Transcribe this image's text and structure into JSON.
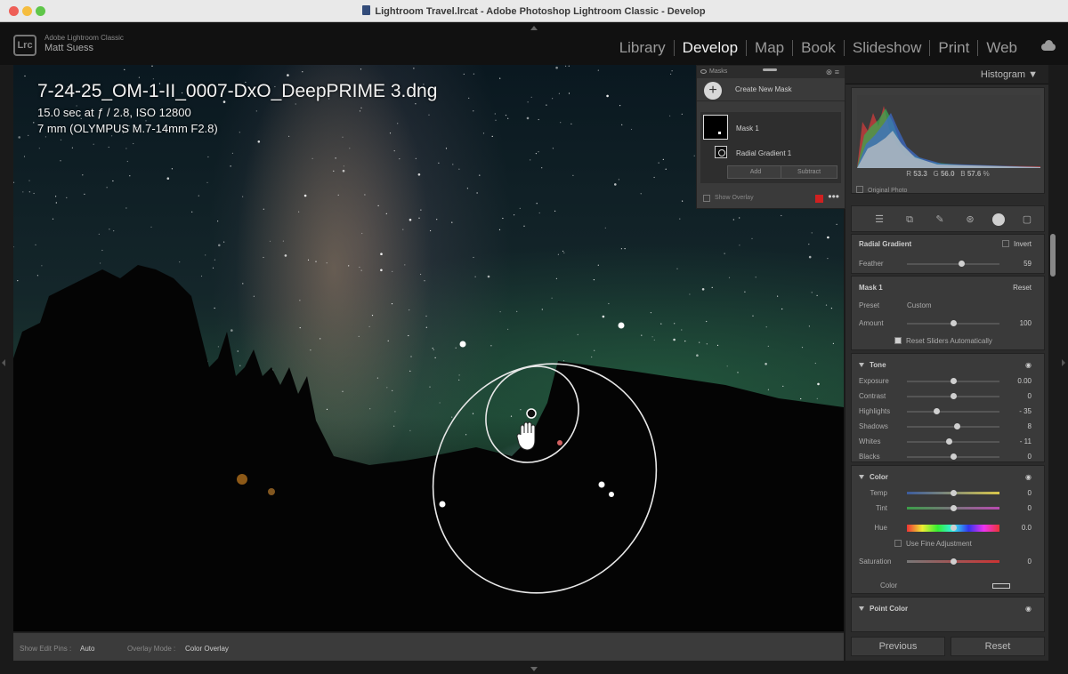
{
  "window": {
    "title": "Lightroom Travel.lrcat - Adobe Photoshop Lightroom Classic - Develop"
  },
  "identity": {
    "logo": "Lrc",
    "app": "Adobe Lightroom Classic",
    "user": "Matt Suess"
  },
  "modules": [
    {
      "label": "Library",
      "active": false
    },
    {
      "label": "Develop",
      "active": true
    },
    {
      "label": "Map",
      "active": false
    },
    {
      "label": "Book",
      "active": false
    },
    {
      "label": "Slideshow",
      "active": false
    },
    {
      "label": "Print",
      "active": false
    },
    {
      "label": "Web",
      "active": false
    }
  ],
  "photo_info": {
    "filename": "7-24-25_OM-1-II_0007-DxO_DeepPRIME 3.dng",
    "exposure": "15.0 sec at ƒ / 2.8, ISO 12800",
    "lens": "7 mm (OLYMPUS M.7-14mm F2.8)"
  },
  "masks_panel": {
    "title": "Masks",
    "create_label": "Create New Mask",
    "mask_name": "Mask 1",
    "component": "Radial Gradient 1",
    "add_label": "Add",
    "subtract_label": "Subtract",
    "show_overlay": "Show Overlay",
    "overlay_color": "#d02020"
  },
  "histogram": {
    "title": "Histogram",
    "r_label": "R",
    "r": "53.3",
    "g_label": "G",
    "g": "56.0",
    "b_label": "B",
    "b": "57.6",
    "unit": "%",
    "original_photo": "Original Photo"
  },
  "radial": {
    "title": "Radial Gradient",
    "invert": "Invert",
    "feather_label": "Feather",
    "feather": "59",
    "feather_pos": 0.59
  },
  "mask_section": {
    "title": "Mask 1",
    "reset": "Reset",
    "preset_label": "Preset",
    "preset_value": "Custom",
    "amount_label": "Amount",
    "amount": "100",
    "amount_pos": 0.5,
    "reset_sliders": "Reset Sliders Automatically"
  },
  "light": {
    "title": "Tone",
    "sliders": [
      {
        "label": "Exposure",
        "value": "0.00",
        "pos": 0.5
      },
      {
        "label": "Contrast",
        "value": "0",
        "pos": 0.5
      },
      {
        "label": "Highlights",
        "value": "- 35",
        "pos": 0.32
      },
      {
        "label": "Shadows",
        "value": "8",
        "pos": 0.54
      },
      {
        "label": "Whites",
        "value": "- 11",
        "pos": 0.45
      },
      {
        "label": "Blacks",
        "value": "0",
        "pos": 0.5
      }
    ]
  },
  "color": {
    "title": "Color",
    "temp_label": "Temp",
    "temp": "0",
    "temp_pos": 0.5,
    "tint_label": "Tint",
    "tint": "0",
    "tint_pos": 0.5,
    "hue_label": "Hue",
    "hue": "0.0",
    "hue_pos": 0.5,
    "fine_label": "Use Fine Adjustment",
    "sat_label": "Saturation",
    "sat": "0",
    "sat_pos": 0.5,
    "color_label": "Color"
  },
  "point_color": {
    "title": "Point Color"
  },
  "buttons": {
    "previous": "Previous",
    "reset": "Reset"
  },
  "toolbar": {
    "show_edit_pins_label": "Show Edit Pins :",
    "show_edit_pins_value": "Auto",
    "overlay_mode_label": "Overlay Mode :",
    "overlay_mode_value": "Color Overlay"
  }
}
